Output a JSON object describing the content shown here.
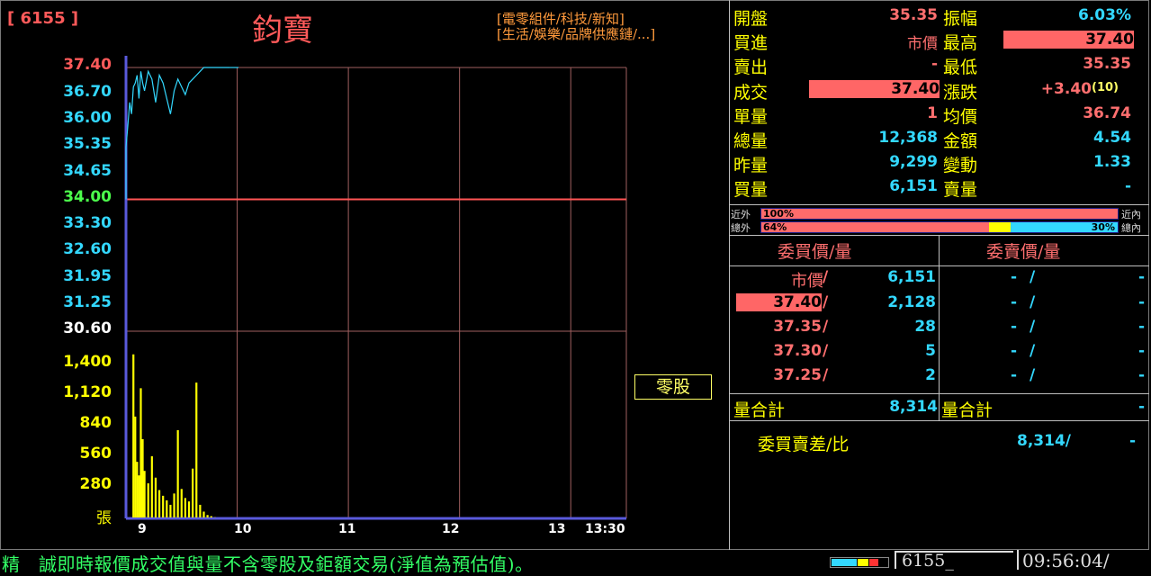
{
  "stock": {
    "code": "[ 6155 ]",
    "name": "鈞寶",
    "tags": [
      "[電零組件/科技/新知]",
      "[生活/娛樂/品牌供應鏈/...]"
    ]
  },
  "price_axis": [
    "37.40",
    "36.70",
    "36.00",
    "35.35",
    "34.65",
    "34.00",
    "33.30",
    "32.60",
    "31.95",
    "31.25",
    "30.60"
  ],
  "volume_axis": [
    "1,400",
    "1,120",
    "840",
    "560",
    "280"
  ],
  "volume_unit": "張",
  "time_axis": [
    "9",
    "10",
    "11",
    "12",
    "13",
    "13:30"
  ],
  "odd_lot_button": "零股",
  "quote": {
    "open_label": "開盤",
    "open": "35.35",
    "amplitude_label": "振幅",
    "amplitude": "6.03%",
    "bid_label": "買進",
    "bid": "市價",
    "high_label": "最高",
    "high": "37.40",
    "ask_label": "賣出",
    "ask": "-",
    "low_label": "最低",
    "low": "35.35",
    "last_label": "成交",
    "last": "37.40",
    "change_label": "漲跌",
    "change": "+3.40",
    "change_pct": "(10)",
    "lot_label": "單量",
    "lot": "1",
    "avg_label": "均價",
    "avg": "36.74",
    "total_vol_label": "總量",
    "total_vol": "12,368",
    "amount_label": "金額",
    "amount": "4.54",
    "prev_vol_label": "昨量",
    "prev_vol": "9,299",
    "turnover_label": "變動",
    "turnover": "1.33",
    "buy_vol_label": "買量",
    "buy_vol": "6,151",
    "sell_vol_label": "賣量",
    "sell_vol": "-"
  },
  "pressure": {
    "near_out_label": "近外",
    "near_in_label": "近內",
    "near_out_pct": "100%",
    "total_out_label": "總外",
    "total_in_label": "總內",
    "total_out_pct": "64%",
    "total_in_pct": "30%",
    "near_out_fraction": 1.0,
    "total_out_fraction": 0.64,
    "total_in_fraction": 0.3
  },
  "orderbook": {
    "bid_header": "委買價/量",
    "ask_header": "委賣價/量",
    "rows": [
      {
        "bid_price": "市價",
        "bid_qty": "6,151",
        "ask_price": "-",
        "ask_qty": "-"
      },
      {
        "bid_price": "37.40",
        "bid_qty": "2,128",
        "ask_price": "-",
        "ask_qty": "-"
      },
      {
        "bid_price": "37.35",
        "bid_qty": "28",
        "ask_price": "-",
        "ask_qty": "-"
      },
      {
        "bid_price": "37.30",
        "bid_qty": "5",
        "ask_price": "-",
        "ask_qty": "-"
      },
      {
        "bid_price": "37.25",
        "bid_qty": "2",
        "ask_price": "-",
        "ask_qty": "-"
      }
    ],
    "slash": "/",
    "bid_total_label": "量合計",
    "bid_total": "8,314",
    "ask_total_label": "量合計",
    "ask_total": "-",
    "diff_label": "委買賣差/比",
    "diff_value": "8,314/",
    "diff_ratio": "-"
  },
  "status_bar": {
    "ticker_text": "精　誠即時報價成交值與量不含零股及鉅額交易(淨值為預估值)。",
    "code_box": "6155_",
    "time": "09:56:04/"
  },
  "colors": {
    "price_line": "#33d8ff",
    "volume_bar": "#ffff00",
    "ref_line": "#ff5555",
    "axis": "#5a5adc"
  },
  "chart_data": {
    "type": "line",
    "x_range": [
      "09:00",
      "13:30"
    ],
    "ylim": [
      30.6,
      37.4
    ],
    "reference_price": 34.0,
    "price_series": {
      "x": [
        "09:00",
        "09:01",
        "09:02",
        "09:03",
        "09:04",
        "09:05",
        "09:06",
        "09:07",
        "09:08",
        "09:09",
        "09:10",
        "09:12",
        "09:14",
        "09:16",
        "09:18",
        "09:20",
        "09:22",
        "09:24",
        "09:26",
        "09:28",
        "09:30",
        "09:32",
        "09:34",
        "09:36",
        "09:38",
        "09:40",
        "09:42",
        "09:44",
        "09:46",
        "09:48",
        "09:50",
        "09:52",
        "09:54",
        "09:56"
      ],
      "values": [
        35.35,
        35.9,
        36.5,
        36.2,
        36.9,
        37.0,
        37.2,
        36.6,
        37.3,
        37.0,
        36.8,
        37.3,
        37.1,
        36.5,
        37.2,
        37.0,
        36.6,
        36.2,
        36.8,
        37.1,
        36.9,
        36.7,
        37.0,
        37.1,
        37.2,
        37.3,
        37.4,
        37.4,
        37.4,
        37.4,
        37.4,
        37.4,
        37.4,
        37.4
      ]
    },
    "volume_series": {
      "x": [
        "09:04",
        "09:05",
        "09:06",
        "09:07",
        "09:08",
        "09:09",
        "09:10",
        "09:12",
        "09:14",
        "09:16",
        "09:18",
        "09:20",
        "09:22",
        "09:24",
        "09:26",
        "09:28",
        "09:30",
        "09:32",
        "09:34",
        "09:36",
        "09:38",
        "09:40",
        "09:42",
        "09:44",
        "09:46",
        "09:48"
      ],
      "values": [
        1450,
        900,
        500,
        380,
        1150,
        700,
        420,
        310,
        550,
        360,
        250,
        200,
        160,
        120,
        220,
        780,
        260,
        180,
        150,
        440,
        1200,
        120,
        60,
        30,
        20,
        10
      ]
    },
    "volume_ylim": [
      0,
      1400
    ]
  }
}
